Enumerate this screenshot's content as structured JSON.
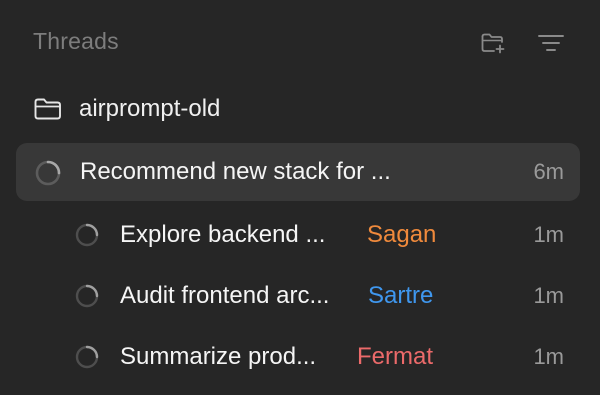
{
  "header": {
    "title": "Threads",
    "new_folder_icon": "folder-plus-icon",
    "filter_icon": "filter-lines-icon"
  },
  "project": {
    "name": "airprompt-old",
    "icon": "folder-icon"
  },
  "thread": {
    "title": "Recommend new stack for ...",
    "time": "6m",
    "status_icon": "loading-spinner-icon"
  },
  "subthreads": [
    {
      "title": "Explore backend ...",
      "agent": "Sagan",
      "agent_color": "#f08a3c",
      "time": "1m"
    },
    {
      "title": "Audit frontend arc...",
      "agent": "Sartre",
      "agent_color": "#3f97ee",
      "time": "1m"
    },
    {
      "title": "Summarize prod...",
      "agent": "Fermat",
      "agent_color": "#ec6a6a",
      "time": "1m"
    }
  ],
  "colors": {
    "background": "#262626",
    "selected_row": "#383838",
    "muted_text": "#7d7d7d",
    "time_text": "#9a9a9a"
  }
}
